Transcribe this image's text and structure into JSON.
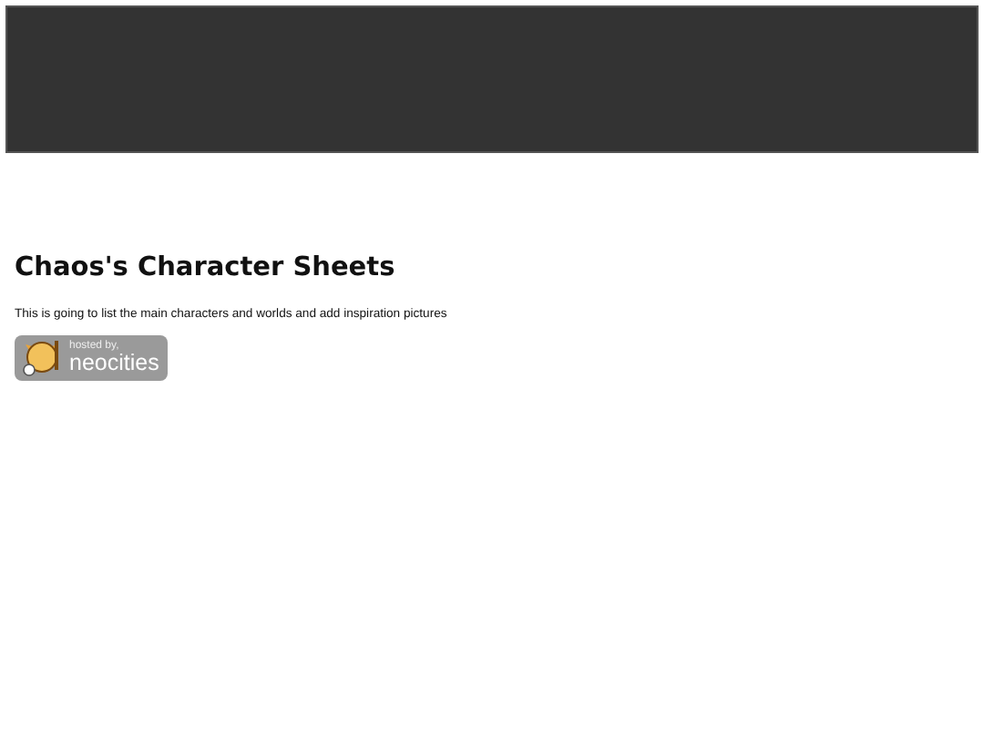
{
  "heading": "Chaos's Character Sheets",
  "intro": "This is going to list the main characters and worlds and add inspiration pictures",
  "badge": {
    "small_text": "hosted by,",
    "large_text": "neocities"
  }
}
